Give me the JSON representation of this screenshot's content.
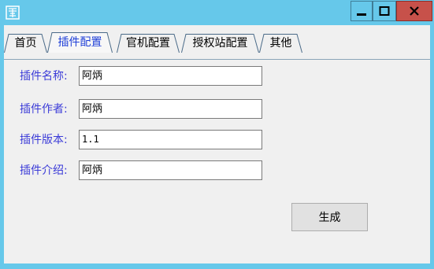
{
  "window": {
    "icon": "app-logo-icon",
    "controls": {
      "minimize": "minimize-icon",
      "maximize": "maximize-icon",
      "close": "close-icon"
    }
  },
  "tabs": [
    {
      "label": "首页",
      "active": false
    },
    {
      "label": "插件配置",
      "active": true
    },
    {
      "label": "官机配置",
      "active": false
    },
    {
      "label": "授权站配置",
      "active": false
    },
    {
      "label": "其他",
      "active": false
    }
  ],
  "form": {
    "fields": [
      {
        "label": "插件名称:",
        "value": "阿炳"
      },
      {
        "label": "插件作者:",
        "value": "阿炳"
      },
      {
        "label": "插件版本:",
        "value": "1.1"
      },
      {
        "label": "插件介绍:",
        "value": "阿炳"
      }
    ],
    "generate_label": "生成"
  },
  "colors": {
    "titlebar": "#66c8ea",
    "close": "#c7514a",
    "label": "#3c3cd8",
    "active_tab": "#1f3fd8"
  }
}
